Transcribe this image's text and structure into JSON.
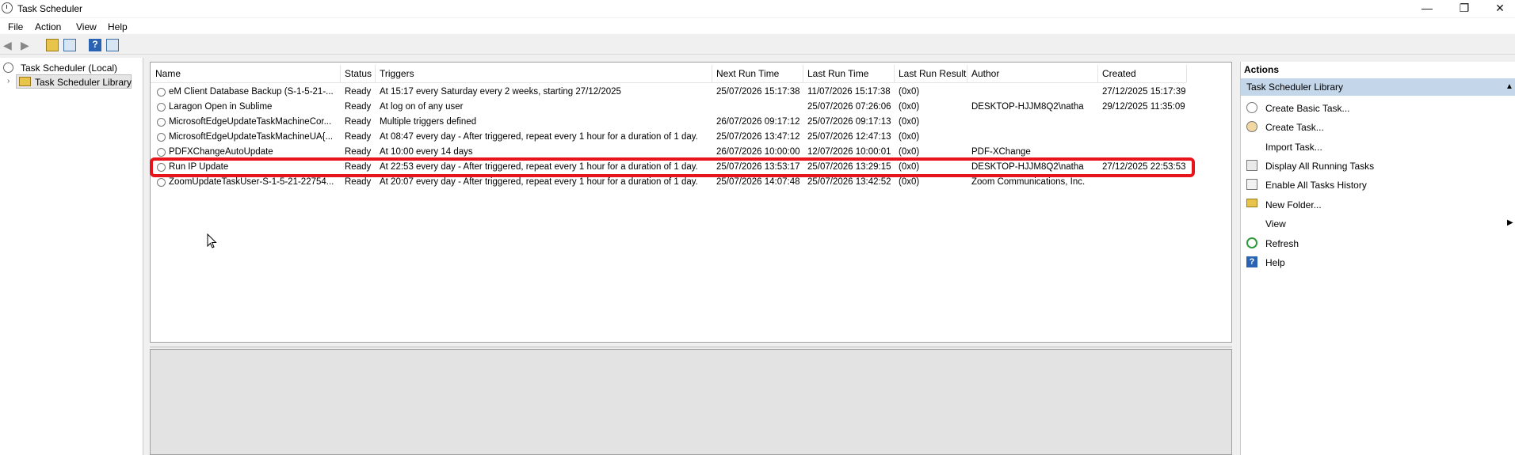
{
  "window": {
    "title": "Task Scheduler",
    "minimize": "—",
    "maximize": "❐",
    "close": "✕"
  },
  "menu": [
    "File",
    "Action",
    "View",
    "Help"
  ],
  "tree": {
    "root": "Task Scheduler (Local)",
    "child": "Task Scheduler Library"
  },
  "table": {
    "columns": [
      "Name",
      "Status",
      "Triggers",
      "Next Run Time",
      "Last Run Time",
      "Last Run Result",
      "Author",
      "Created"
    ],
    "rows": [
      [
        "eM Client Database Backup (S-1-5-21-...",
        "Ready",
        "At 15:17 every Saturday every 2 weeks, starting 27/12/2025",
        "25/07/2026 15:17:38",
        "11/07/2026 15:17:38",
        "(0x0)",
        "",
        "27/12/2025 15:17:39"
      ],
      [
        "Laragon Open in Sublime",
        "Ready",
        "At log on of any user",
        "",
        "25/07/2026 07:26:06",
        "(0x0)",
        "DESKTOP-HJJM8Q2\\natha",
        "29/12/2025 11:35:09"
      ],
      [
        "MicrosoftEdgeUpdateTaskMachineCor...",
        "Ready",
        "Multiple triggers defined",
        "26/07/2026 09:17:12",
        "25/07/2026 09:17:13",
        "(0x0)",
        "",
        ""
      ],
      [
        "MicrosoftEdgeUpdateTaskMachineUA{...",
        "Ready",
        "At 08:47 every day - After triggered, repeat every 1 hour for a duration of 1 day.",
        "25/07/2026 13:47:12",
        "25/07/2026 12:47:13",
        "(0x0)",
        "",
        ""
      ],
      [
        "PDFXChangeAutoUpdate",
        "Ready",
        "At 10:00 every 14 days",
        "26/07/2026 10:00:00",
        "12/07/2026 10:00:01",
        "(0x0)",
        "PDF-XChange",
        ""
      ],
      [
        "Run IP Update",
        "Ready",
        "At 22:53 every day - After triggered, repeat every 1 hour for a duration of 1 day.",
        "25/07/2026 13:53:17",
        "25/07/2026 13:29:15",
        "(0x0)",
        "DESKTOP-HJJM8Q2\\natha",
        "27/12/2025 22:53:53"
      ],
      [
        "ZoomUpdateTaskUser-S-1-5-21-22754...",
        "Ready",
        "At 20:07 every day - After triggered, repeat every 1 hour for a duration of 1 day.",
        "25/07/2026 14:07:48",
        "25/07/2026 13:42:52",
        "(0x0)",
        "Zoom Communications, Inc.",
        ""
      ]
    ]
  },
  "actions": {
    "title": "Actions",
    "section": "Task Scheduler Library",
    "items": [
      {
        "label": "Create Basic Task...",
        "icon": "create-basic-task-icon"
      },
      {
        "label": "Create Task...",
        "icon": "create-task-icon"
      },
      {
        "label": "Import Task...",
        "icon": ""
      },
      {
        "label": "Display All Running Tasks",
        "icon": "running-tasks-icon"
      },
      {
        "label": "Enable All Tasks History",
        "icon": "history-icon"
      },
      {
        "label": "New Folder...",
        "icon": "folder-icon"
      },
      {
        "label": "View",
        "icon": ""
      },
      {
        "label": "Refresh",
        "icon": "refresh-icon"
      },
      {
        "label": "Help",
        "icon": "help-icon"
      }
    ]
  },
  "colors": {
    "highlight": "#e8141c",
    "section": "#c4d6ea"
  }
}
